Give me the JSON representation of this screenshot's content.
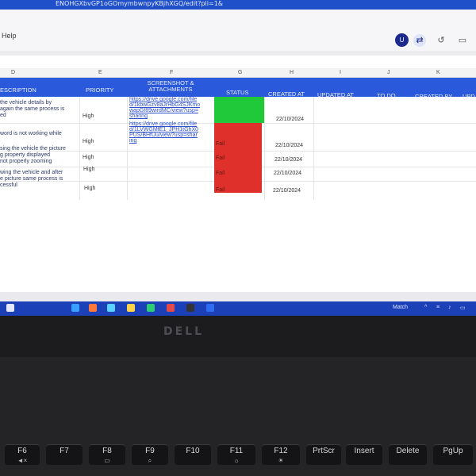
{
  "browser": {
    "url_fragment": "ENOHGXbvGP1oGOmymbwnpyKBjhXGQ/edit?pli=1&"
  },
  "menu": {
    "help": "Help"
  },
  "account": {
    "avatar_letter": "U"
  },
  "icons": {
    "share": "share-icon",
    "history": "history-icon",
    "video": "video-call-icon"
  },
  "columns": {
    "letters": [
      "D",
      "E",
      "F",
      "G",
      "H",
      "I",
      "J",
      "K"
    ]
  },
  "table": {
    "headers": [
      "ESCRIPTION",
      "PRIORITY",
      "SCREENSHOT & ATTACHMENTS",
      "STATUS",
      "CREATED AT",
      "UPDATED AT",
      "TO DO",
      "CREATED BY",
      "UPD"
    ],
    "rows": [
      {
        "description": [
          "the vehicle details by",
          "again the same process is",
          "ed"
        ],
        "priority": "High",
        "attachment": [
          "https://drive.google.com/file",
          "d/1kbwGzv8aJrHbG4SJKmo",
          "wapGf89wirdMC/view?usp=",
          "sharing"
        ],
        "status": "",
        "status_color": "#1fc93a",
        "created": "22/10/2024"
      },
      {
        "description": [
          "word is not working while"
        ],
        "priority": "High",
        "attachment": [
          "https://drive.google.com/file",
          "d/1LVWGMfE1_JPH1tGhX0",
          "PUS/BHfUu/view?usp=shar",
          "ing"
        ],
        "status": "Fail",
        "status_color": "#e0302b",
        "created": "22/10/2024"
      },
      {
        "description": [
          "sing the vehicle the picture",
          "g property displayed",
          "not properly zooming"
        ],
        "priority": "High",
        "attachment": [],
        "status": "Fail",
        "status_color": "#e0302b",
        "created": "22/10/2024"
      },
      {
        "description": [
          "wing the vehicle and after",
          "e picture same process is",
          "cessful"
        ],
        "priority": "High",
        "attachment": [],
        "status": "Fail",
        "status_color": "#e0302b",
        "created": "22/10/2024"
      },
      {
        "description": [],
        "priority": "High",
        "attachment": [],
        "status": "Fail",
        "status_color": "#e0302b",
        "created": "22/10/2024"
      }
    ]
  },
  "taskbar": {
    "search_label": "Match"
  },
  "laptop": {
    "brand": "DELL"
  },
  "keys": [
    {
      "label": "F6",
      "icon": "mute-icon"
    },
    {
      "label": "F7",
      "icon": ""
    },
    {
      "label": "F8",
      "icon": "display-icon"
    },
    {
      "label": "F9",
      "icon": "search-icon"
    },
    {
      "label": "F10",
      "icon": ""
    },
    {
      "label": "F11",
      "icon": "brightness-down-icon"
    },
    {
      "label": "F12",
      "icon": "brightness-up-icon"
    },
    {
      "label": "PrtScr",
      "icon": ""
    },
    {
      "label": "Insert",
      "icon": ""
    },
    {
      "label": "Delete",
      "icon": ""
    },
    {
      "label": "PgUp",
      "icon": ""
    }
  ]
}
